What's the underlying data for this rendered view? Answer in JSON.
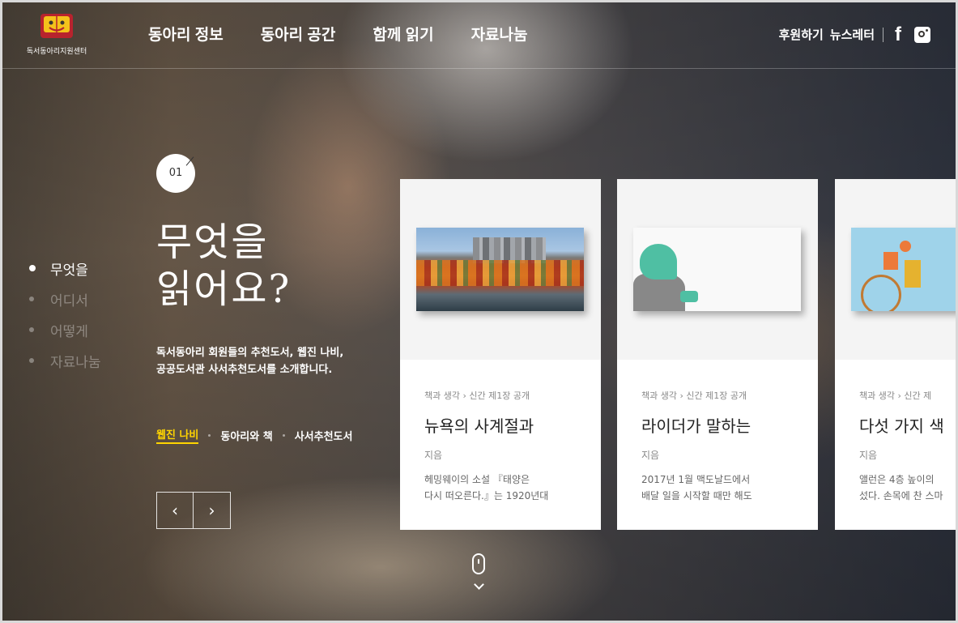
{
  "brand": {
    "name": "독서동아리지원센터",
    "colors": {
      "red": "#b8232d",
      "yellow": "#f4c21b"
    }
  },
  "nav": [
    "동아리 정보",
    "동아리 공간",
    "함께 읽기",
    "자료나눔"
  ],
  "util": {
    "support": "후원하기",
    "newsletter": "뉴스레터",
    "facebook_icon": "facebook-icon",
    "instagram_icon": "instagram-icon"
  },
  "side_nav": [
    {
      "label": "무엇을",
      "active": true
    },
    {
      "label": "어디서",
      "active": false
    },
    {
      "label": "어떻게",
      "active": false
    },
    {
      "label": "자료나눔",
      "active": false
    }
  ],
  "hero": {
    "number": "01",
    "title_line1": "무엇을",
    "title_line2": "읽어요?",
    "desc_line1": "독서동아리 회원들의 추천도서, 웹진 나비,",
    "desc_line2": "공공도서관 사서추천도서를 소개합니다.",
    "links": [
      "웹진 나비",
      "동아리와 책",
      "사서추천도서"
    ],
    "active_link_color": "#ffd400",
    "prev": "‹",
    "next": "›"
  },
  "cards": [
    {
      "crumb": "책과 생각 › 신간 제1장 공개",
      "title": "뉴욕의 사계절과",
      "author": "지음",
      "excerpt1": "헤밍웨이의 소설 『태양은",
      "excerpt2": "다시 떠오른다.』는 1920년대"
    },
    {
      "crumb": "책과 생각 › 신간 제1장 공개",
      "title": "라이더가 말하는",
      "author": "지음",
      "excerpt1": "2017년 1월 맥도날드에서",
      "excerpt2": "배달 일을 시작할 때만 해도"
    },
    {
      "crumb": "책과 생각 › 신간 제",
      "title": "다섯 가지 색",
      "author": "지음",
      "excerpt1": "앨런은 4층 높이의",
      "excerpt2": "섰다. 손목에 찬 스마"
    }
  ]
}
